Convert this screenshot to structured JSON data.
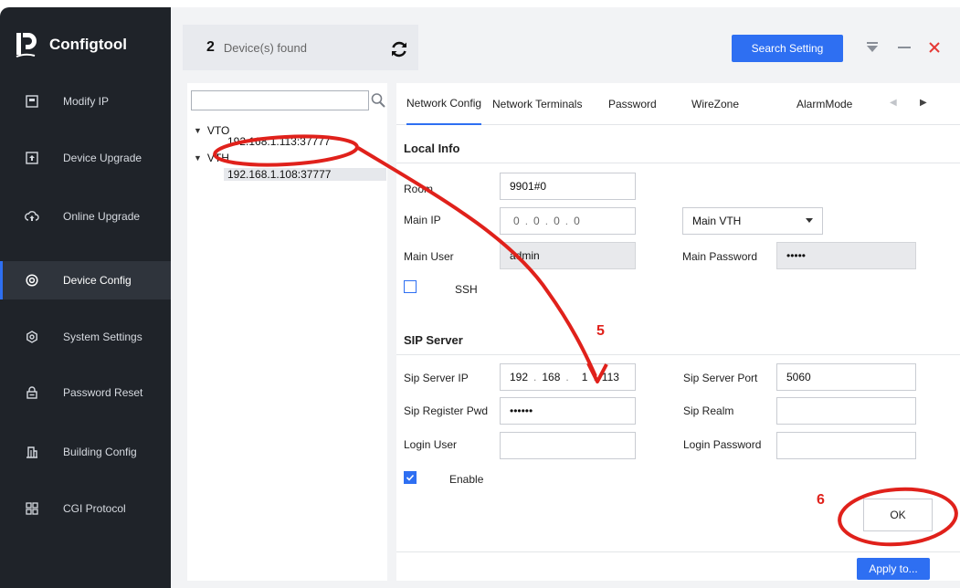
{
  "app": {
    "name": "Configtool"
  },
  "sidebar": {
    "items": [
      {
        "label": "Modify IP",
        "icon": "modify-ip-icon"
      },
      {
        "label": "Device Upgrade",
        "icon": "upgrade-icon"
      },
      {
        "label": "Online Upgrade",
        "icon": "cloud-upgrade-icon"
      },
      {
        "label": "Device Config",
        "icon": "device-config-icon",
        "active": true
      },
      {
        "label": "System Settings",
        "icon": "settings-icon"
      },
      {
        "label": "Password Reset",
        "icon": "password-reset-icon"
      },
      {
        "label": "Building Config",
        "icon": "building-icon"
      },
      {
        "label": "CGI Protocol",
        "icon": "cgi-protocol-icon"
      }
    ]
  },
  "topbar": {
    "count": "2",
    "count_label": "Device(s) found",
    "search_setting": "Search Setting"
  },
  "tree": {
    "search_placeholder": "",
    "groups": [
      {
        "label": "VTO",
        "devices": [
          "192.168.1.113:37777"
        ]
      },
      {
        "label": "VTH",
        "devices": [
          "192.168.1.108:37777"
        ]
      }
    ]
  },
  "tabs": [
    "Network Config",
    "Network Terminals",
    "Password",
    "WireZone",
    "AlarmMode"
  ],
  "local_info": {
    "title": "Local Info",
    "room_label": "Room",
    "room_value": "9901#0",
    "main_ip_label": "Main IP",
    "main_ip": [
      "0",
      "0",
      "0",
      "0"
    ],
    "main_vth_value": "Main VTH",
    "main_user_label": "Main User",
    "main_user_value": "admin",
    "main_password_label": "Main Password",
    "main_password_value": "•••••",
    "ssh_label": "SSH",
    "ssh_checked": false
  },
  "sip_server": {
    "title": "SIP Server",
    "ip_label": "Sip Server IP",
    "ip": [
      "192",
      "168",
      "1",
      "113"
    ],
    "port_label": "Sip Server Port",
    "port_value": "5060",
    "register_pwd_label": "Sip Register Pwd",
    "register_pwd_value": "••••••",
    "realm_label": "Sip Realm",
    "realm_value": "",
    "login_user_label": "Login User",
    "login_user_value": "",
    "login_password_label": "Login Password",
    "login_password_value": "",
    "enable_label": "Enable",
    "enable_checked": true
  },
  "buttons": {
    "ok": "OK",
    "apply": "Apply to..."
  },
  "annotations": {
    "step5": "5",
    "step6": "6"
  },
  "colors": {
    "accent": "#2e6ff2",
    "sidebar_bg": "#1f2329",
    "annotation": "#e0211b"
  }
}
